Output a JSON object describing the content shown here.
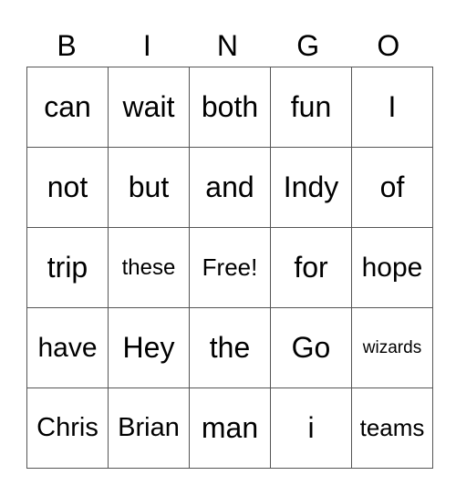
{
  "header": {
    "letters": [
      "B",
      "I",
      "N",
      "G",
      "O"
    ]
  },
  "card": {
    "rows": [
      [
        "can",
        "wait",
        "both",
        "fun",
        "I"
      ],
      [
        "not",
        "but",
        "and",
        "Indy",
        "of"
      ],
      [
        "trip",
        "these",
        "Free!",
        "for",
        "hope"
      ],
      [
        "have",
        "Hey",
        "the",
        "Go",
        "wizards"
      ],
      [
        "Chris",
        "Brian",
        "man",
        "i",
        "teams"
      ]
    ]
  }
}
